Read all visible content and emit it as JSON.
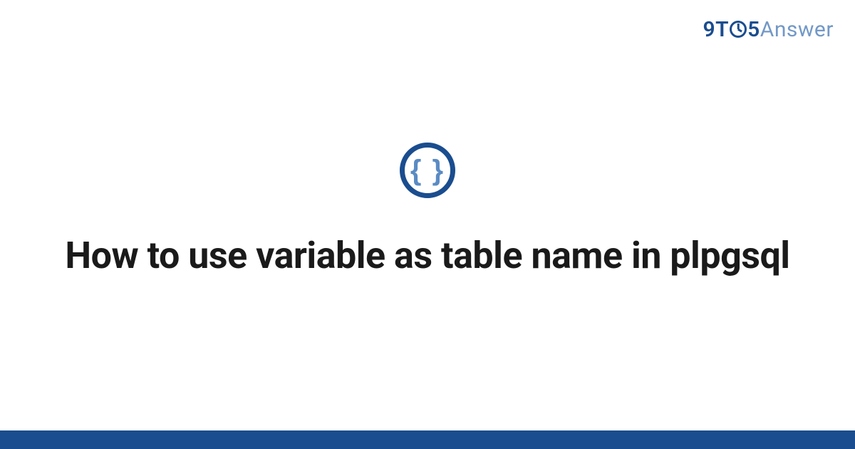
{
  "logo": {
    "part1": "9T",
    "part2": "5",
    "part3": "Answer"
  },
  "icon": {
    "glyph": "{ }"
  },
  "title": "How to use variable as table name in plpgsql",
  "colors": {
    "brand_dark": "#1a4d8f",
    "brand_light": "#7398c7",
    "icon_inner": "#5a8bc4",
    "text": "#1a1a1a"
  }
}
